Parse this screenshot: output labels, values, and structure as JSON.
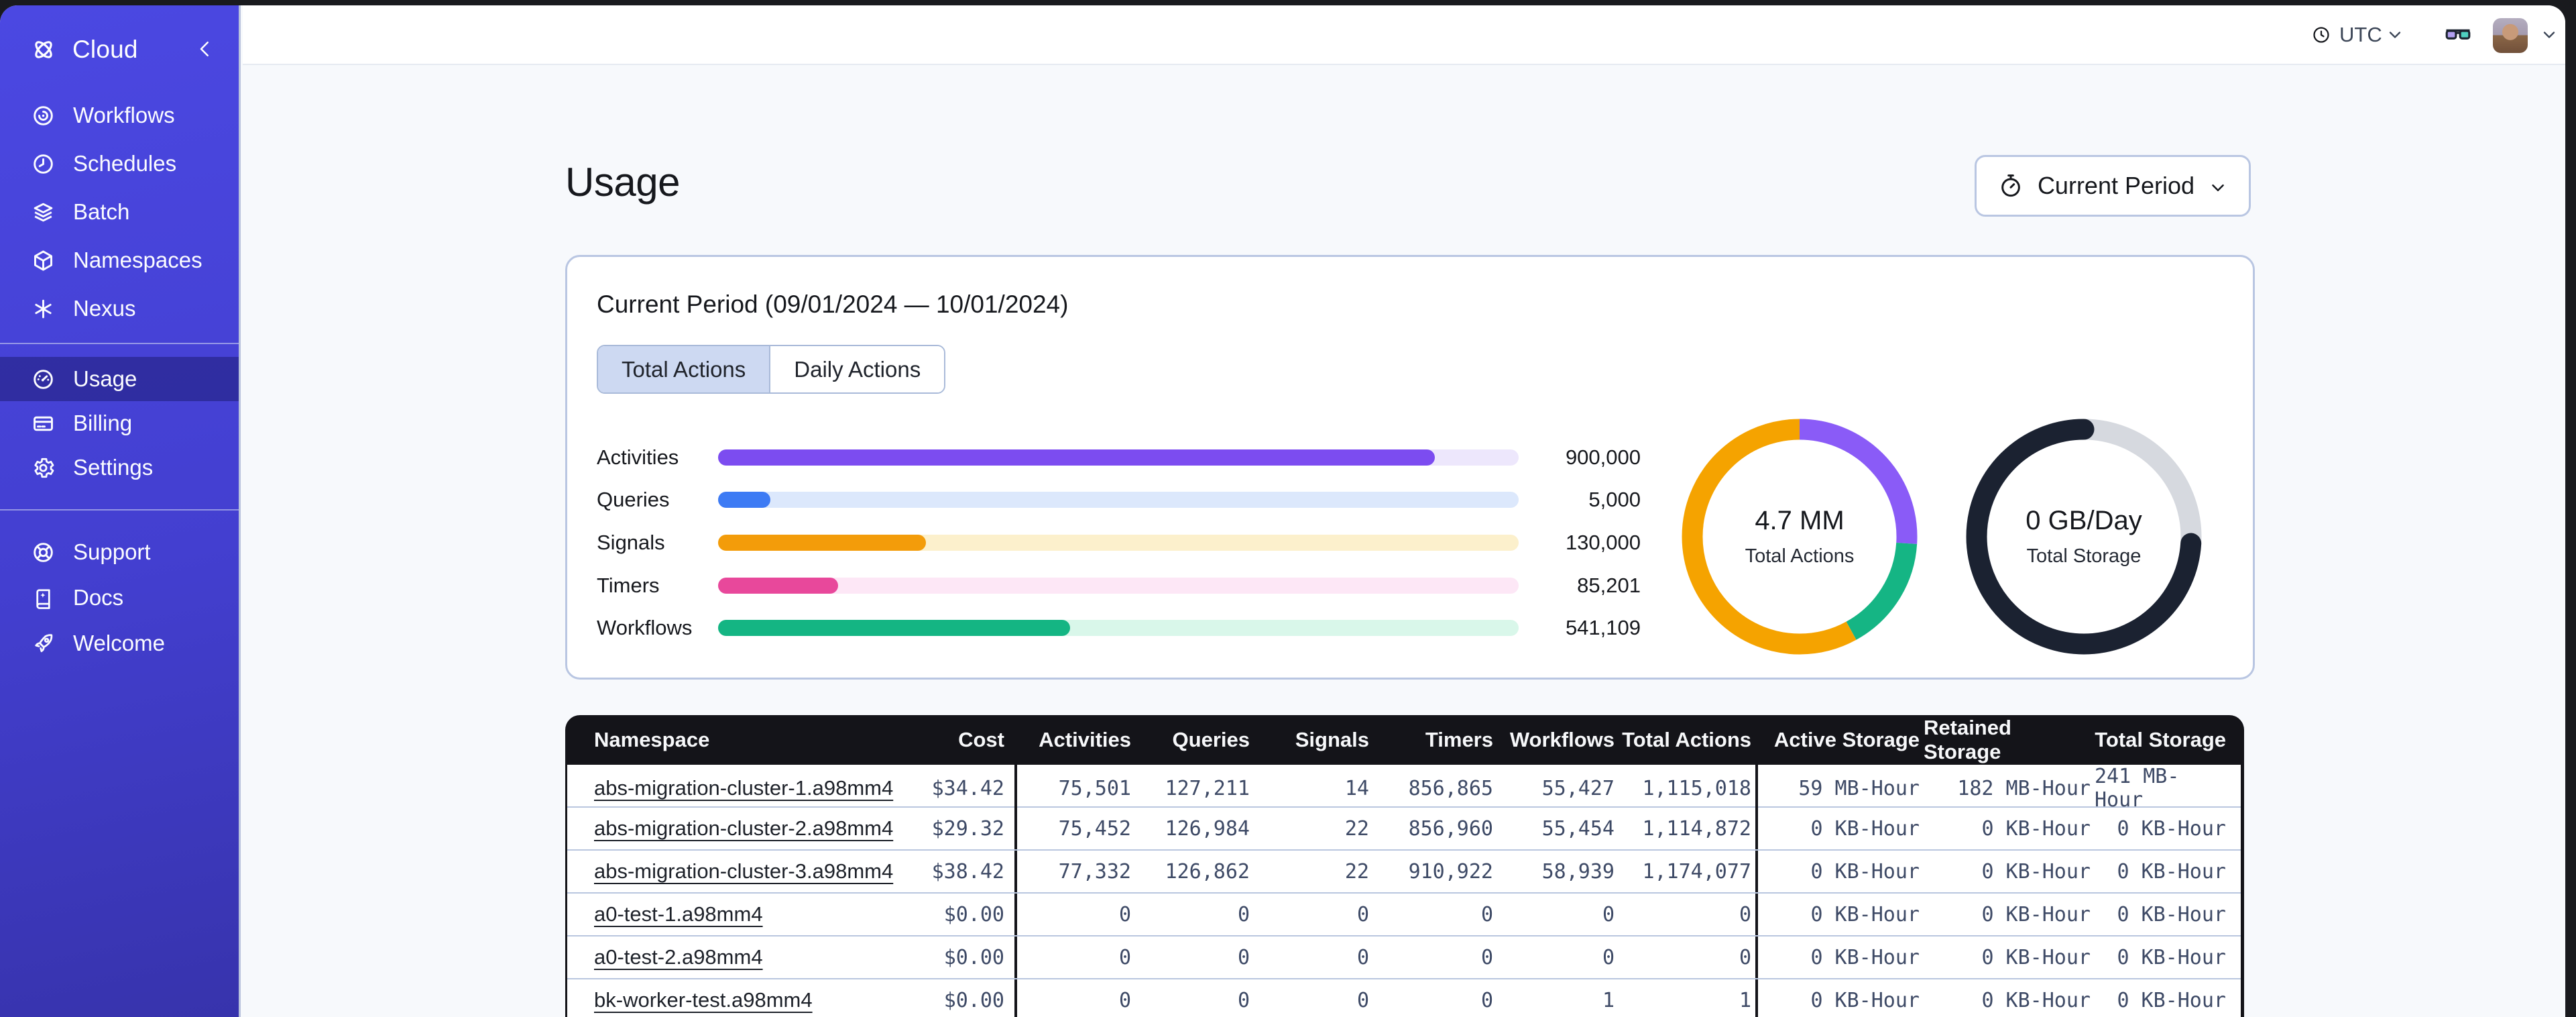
{
  "theme": {
    "sidebar_top": "#4B48E2",
    "sidebar_bottom": "#3733AC",
    "active_item_overlay": "rgba(13,12,76,0.38)",
    "main_background": "#F7F9FC",
    "card_border": "#B9C6E2",
    "table_header_background": "#141419",
    "numeric_text": "#3E4A66"
  },
  "topbar": {
    "timezone": "UTC"
  },
  "sidebar": {
    "brand": "Cloud",
    "nav": [
      {
        "label": "Workflows",
        "icon": "workflows",
        "active": false
      },
      {
        "label": "Schedules",
        "icon": "schedules",
        "active": false
      },
      {
        "label": "Batch",
        "icon": "batch",
        "active": false
      },
      {
        "label": "Namespaces",
        "icon": "namespaces",
        "active": false
      },
      {
        "label": "Nexus",
        "icon": "nexus",
        "active": false
      }
    ],
    "account": [
      {
        "label": "Usage",
        "icon": "usage",
        "active": true
      },
      {
        "label": "Billing",
        "icon": "billing",
        "active": false
      },
      {
        "label": "Settings",
        "icon": "settings",
        "active": false
      }
    ],
    "footer": [
      {
        "label": "Support",
        "icon": "support",
        "active": false
      },
      {
        "label": "Docs",
        "icon": "docs",
        "active": false
      },
      {
        "label": "Welcome",
        "icon": "welcome",
        "active": false
      }
    ]
  },
  "page": {
    "title": "Usage",
    "period_selector_label": "Current Period"
  },
  "card": {
    "title": "Current Period (09/01/2024 — 10/01/2024)",
    "tabs": [
      {
        "label": "Total Actions",
        "active": true
      },
      {
        "label": "Daily Actions",
        "active": false
      }
    ]
  },
  "chart_data": [
    {
      "type": "bar",
      "orientation": "horizontal",
      "categories": [
        "Activities",
        "Queries",
        "Signals",
        "Timers",
        "Workflows"
      ],
      "values": [
        900000,
        5000,
        130000,
        85201,
        541109
      ],
      "value_labels": [
        "900,000",
        "5,000",
        "130,000",
        "85,201",
        "541,109"
      ],
      "bar_colors": [
        "#7C4CF0",
        "#3D7BF4",
        "#F39C0A",
        "#E8489B",
        "#14B583"
      ],
      "track_colors": [
        "#EDE7FC",
        "#DCE8FC",
        "#FCF0CC",
        "#FDE7F6",
        "#D9F7EA"
      ],
      "fill_fractions": [
        0.895,
        0.065,
        0.26,
        0.15,
        0.44
      ],
      "grid": false,
      "legend": false
    },
    {
      "type": "donut",
      "center_value": "4.7 MM",
      "center_label": "Total Actions",
      "segments": [
        {
          "label": "activities",
          "percent": 26,
          "color": "#8A5BF7"
        },
        {
          "label": "workflows",
          "percent": 16,
          "color": "#15B584"
        },
        {
          "label": "signals",
          "percent": 58,
          "color": "#F5A300"
        }
      ]
    },
    {
      "type": "donut",
      "center_value": "0 GB/Day",
      "center_label": "Total Storage",
      "track_color": "#D6D9DF",
      "segments": [
        {
          "label": "storage",
          "percent": 74,
          "start_percent": 26,
          "color": "#1B2231",
          "cap": "round"
        }
      ]
    }
  ],
  "table": {
    "headers": [
      "Namespace",
      "Cost",
      "Activities",
      "Queries",
      "Signals",
      "Timers",
      "Workflows",
      "Total Actions",
      "Active Storage",
      "Retained Storage",
      "Total Storage"
    ],
    "rows": [
      [
        "abs-migration-cluster-1.a98mm4",
        "$34.42",
        "75,501",
        "127,211",
        "14",
        "856,865",
        "55,427",
        "1,115,018",
        "59 MB-Hour",
        "182 MB-Hour",
        "241 MB-Hour"
      ],
      [
        "abs-migration-cluster-2.a98mm4",
        "$29.32",
        "75,452",
        "126,984",
        "22",
        "856,960",
        "55,454",
        "1,114,872",
        "0 KB-Hour",
        "0 KB-Hour",
        "0 KB-Hour"
      ],
      [
        "abs-migration-cluster-3.a98mm4",
        "$38.42",
        "77,332",
        "126,862",
        "22",
        "910,922",
        "58,939",
        "1,174,077",
        "0 KB-Hour",
        "0 KB-Hour",
        "0 KB-Hour"
      ],
      [
        "a0-test-1.a98mm4",
        "$0.00",
        "0",
        "0",
        "0",
        "0",
        "0",
        "0",
        "0 KB-Hour",
        "0 KB-Hour",
        "0 KB-Hour"
      ],
      [
        "a0-test-2.a98mm4",
        "$0.00",
        "0",
        "0",
        "0",
        "0",
        "0",
        "0",
        "0 KB-Hour",
        "0 KB-Hour",
        "0 KB-Hour"
      ],
      [
        "bk-worker-test.a98mm4",
        "$0.00",
        "0",
        "0",
        "0",
        "0",
        "1",
        "1",
        "0 KB-Hour",
        "0 KB-Hour",
        "0 KB-Hour"
      ]
    ]
  }
}
